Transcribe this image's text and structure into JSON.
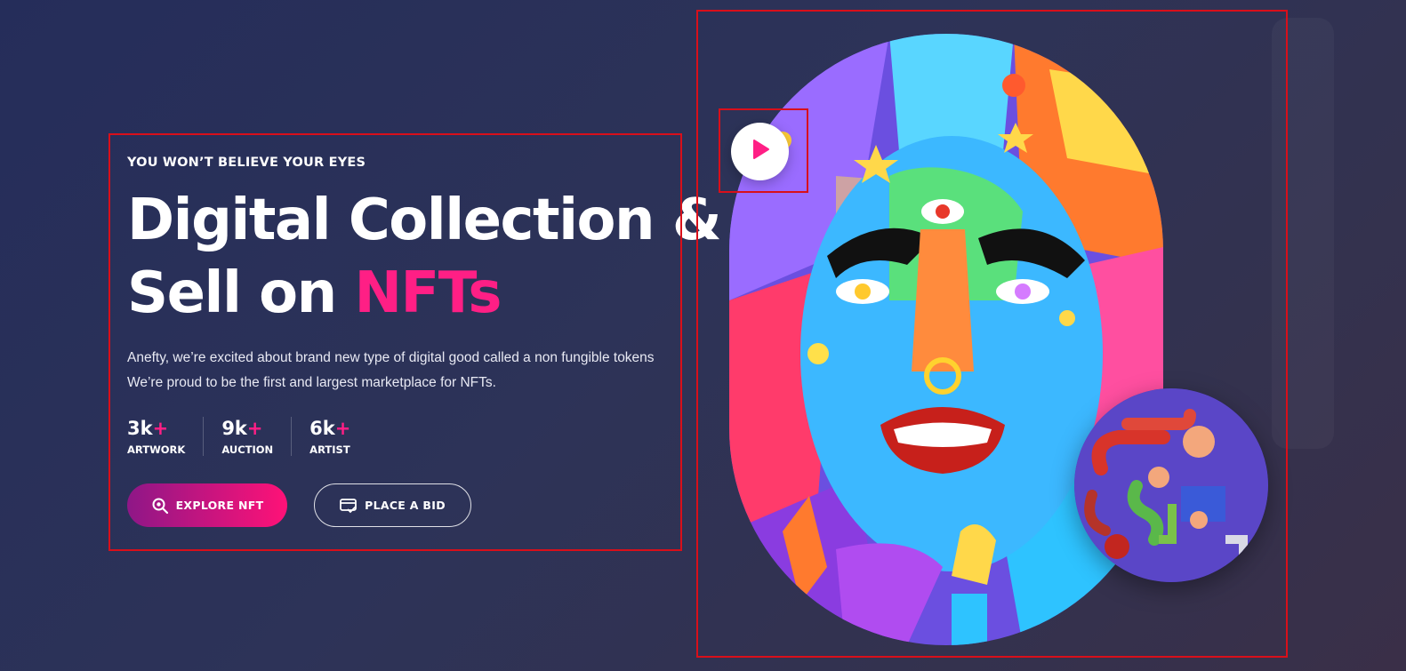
{
  "hero": {
    "subtitle": "YOU WON’T BELIEVE YOUR EYES",
    "title_line1": "Digital Collection &",
    "title_line2_prefix": "Sell on ",
    "title_line2_accent": "NFTs",
    "description_line1": "Anefty, we’re excited about brand new type of digital good called a non fungible tokens",
    "description_line2": "We’re proud to be the first and largest marketplace for NFTs."
  },
  "stats": [
    {
      "value": "3k",
      "suffix": "+",
      "label": "ARTWORK"
    },
    {
      "value": "9k",
      "suffix": "+",
      "label": "AUCTION"
    },
    {
      "value": "6k",
      "suffix": "+",
      "label": "ARTIST"
    }
  ],
  "buttons": {
    "explore": {
      "label": "EXPLORE NFT",
      "icon": "search-gear-icon"
    },
    "bid": {
      "label": "PLACE A BID",
      "icon": "card-check-icon"
    }
  },
  "media": {
    "main_image": "colorful-psychedelic-face-artwork",
    "secondary_image": "abstract-3d-pipes-artwork",
    "play_icon": "play-icon"
  },
  "colors": {
    "accent": "#ff1f85",
    "background": "#2b3157",
    "button_gradient_start": "#8e1787",
    "button_gradient_end": "#ff1277",
    "selection_outline": "#d90f1a"
  }
}
